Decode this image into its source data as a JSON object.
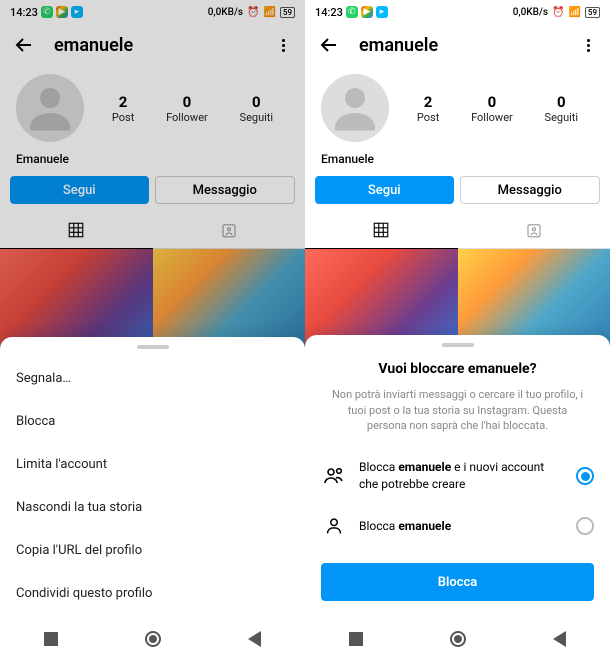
{
  "status": {
    "time": "14:23",
    "speed": "0,0KB/s"
  },
  "profile": {
    "username": "emanuele",
    "displayName": "Emanuele",
    "stats": {
      "posts": {
        "num": "2",
        "label": "Post"
      },
      "followers": {
        "num": "0",
        "label": "Follower"
      },
      "following": {
        "num": "0",
        "label": "Seguiti"
      }
    },
    "followBtn": "Segui",
    "messageBtn": "Messaggio"
  },
  "menu": {
    "items": [
      "Segnala…",
      "Blocca",
      "Limita l'account",
      "Nascondi la tua storia",
      "Copia l'URL del profilo",
      "Condividi questo profilo"
    ]
  },
  "blockSheet": {
    "title": "Vuoi bloccare emanuele?",
    "desc": "Non potrà inviarti messaggi o cercare il tuo profilo, i tuoi post o la tua storia su Instagram. Questa persona non saprà che l'hai bloccata.",
    "opt1_prefix": "Blocca ",
    "opt1_bold": "emanuele",
    "opt1_suffix": " e i nuovi account che potrebbe creare",
    "opt2_prefix": "Blocca ",
    "opt2_bold": "emanuele",
    "action": "Blocca"
  }
}
